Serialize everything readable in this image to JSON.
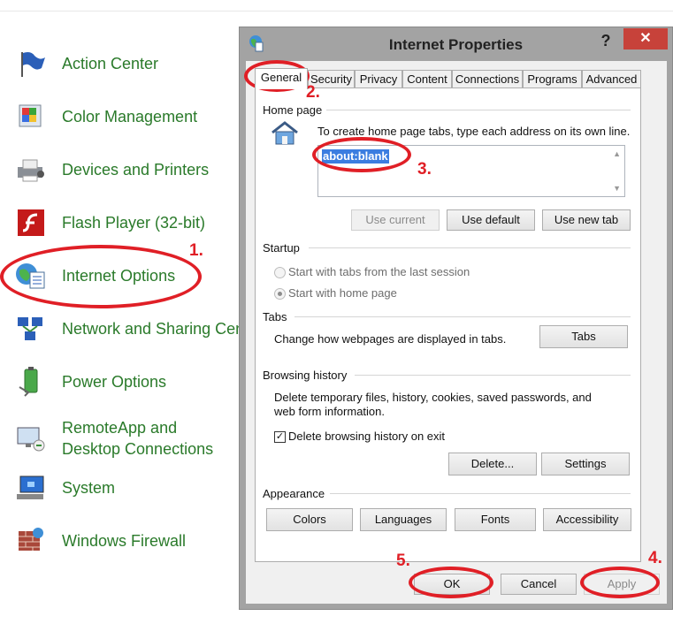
{
  "control_panel": {
    "items": [
      {
        "label": "Action Center",
        "icon": "flag-icon"
      },
      {
        "label": "Color Management",
        "icon": "color-management-icon"
      },
      {
        "label": "Devices and Printers",
        "icon": "printer-icon"
      },
      {
        "label": "Flash Player (32-bit)",
        "icon": "flash-icon"
      },
      {
        "label": "Internet Options",
        "icon": "globe-icon"
      },
      {
        "label": "Network and Sharing Cen",
        "icon": "network-icon"
      },
      {
        "label": "Power Options",
        "icon": "battery-icon"
      },
      {
        "label": "RemoteApp and Desktop Connections",
        "icon": "remote-desktop-icon"
      },
      {
        "label": "System",
        "icon": "monitor-icon"
      },
      {
        "label": "Windows Firewall",
        "icon": "firewall-icon"
      }
    ]
  },
  "window": {
    "title": "Internet Properties",
    "help": "?",
    "close": "✕",
    "tabs": [
      "General",
      "Security",
      "Privacy",
      "Content",
      "Connections",
      "Programs",
      "Advanced"
    ],
    "active_tab": "General",
    "home_page": {
      "group": "Home page",
      "instruction": "To create home page tabs, type each address on its own line.",
      "value": "about:blank",
      "use_current": "Use current",
      "use_default": "Use default",
      "use_new_tab": "Use new tab"
    },
    "startup": {
      "group": "Startup",
      "option1": "Start with tabs from the last session",
      "option2": "Start with home page",
      "selected": "Start with home page"
    },
    "tabs_group": {
      "group": "Tabs",
      "text": "Change how webpages are displayed in tabs.",
      "button": "Tabs"
    },
    "browsing_history": {
      "group": "Browsing history",
      "text1": "Delete temporary files, history, cookies, saved passwords, and",
      "text2": "web form information.",
      "checkbox": "Delete browsing history on exit",
      "checked": true,
      "delete": "Delete...",
      "settings": "Settings"
    },
    "appearance": {
      "group": "Appearance",
      "colors": "Colors",
      "languages": "Languages",
      "fonts": "Fonts",
      "accessibility": "Accessibility"
    },
    "footer": {
      "ok": "OK",
      "cancel": "Cancel",
      "apply": "Apply"
    }
  },
  "annotations": {
    "step1": "1.",
    "step2": "2.",
    "step3": "3.",
    "step4": "4.",
    "step5": "5."
  },
  "colors": {
    "annotation": "#e01f26",
    "link_green": "#2a7a2a",
    "close_red": "#c7423a",
    "selection": "#3b7de0"
  }
}
